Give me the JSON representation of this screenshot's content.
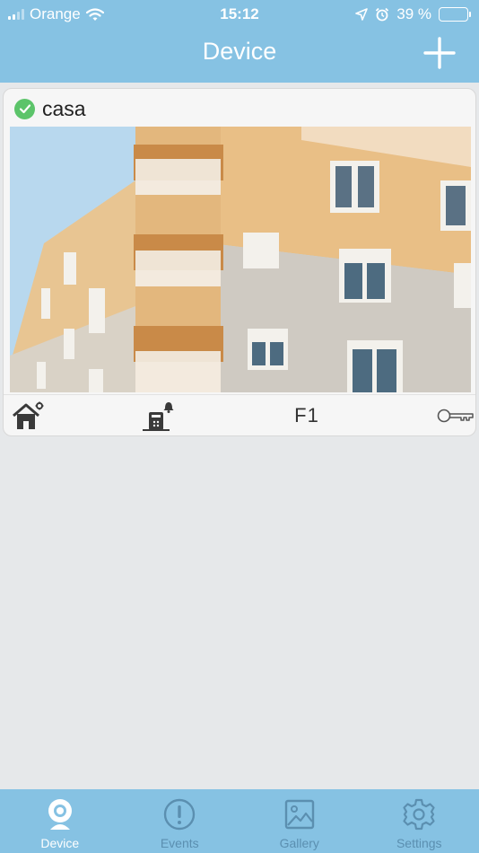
{
  "status_bar": {
    "carrier": "Orange",
    "time": "15:12",
    "battery": "39 %",
    "battery_level": 0.39
  },
  "nav": {
    "title": "Device"
  },
  "device_card": {
    "name": "casa",
    "status": "online",
    "actions": {
      "floor_label": "F1"
    }
  },
  "tabs": [
    {
      "label": "Device",
      "icon": "camera-icon",
      "active": true
    },
    {
      "label": "Events",
      "icon": "alert-circle-icon",
      "active": false
    },
    {
      "label": "Gallery",
      "icon": "image-icon",
      "active": false
    },
    {
      "label": "Settings",
      "icon": "gear-icon",
      "active": false
    }
  ],
  "colors": {
    "bar": "#86c2e3",
    "background": "#e6e8ea",
    "online": "#5cc46a",
    "tab_inactive": "#5b8fb0"
  }
}
